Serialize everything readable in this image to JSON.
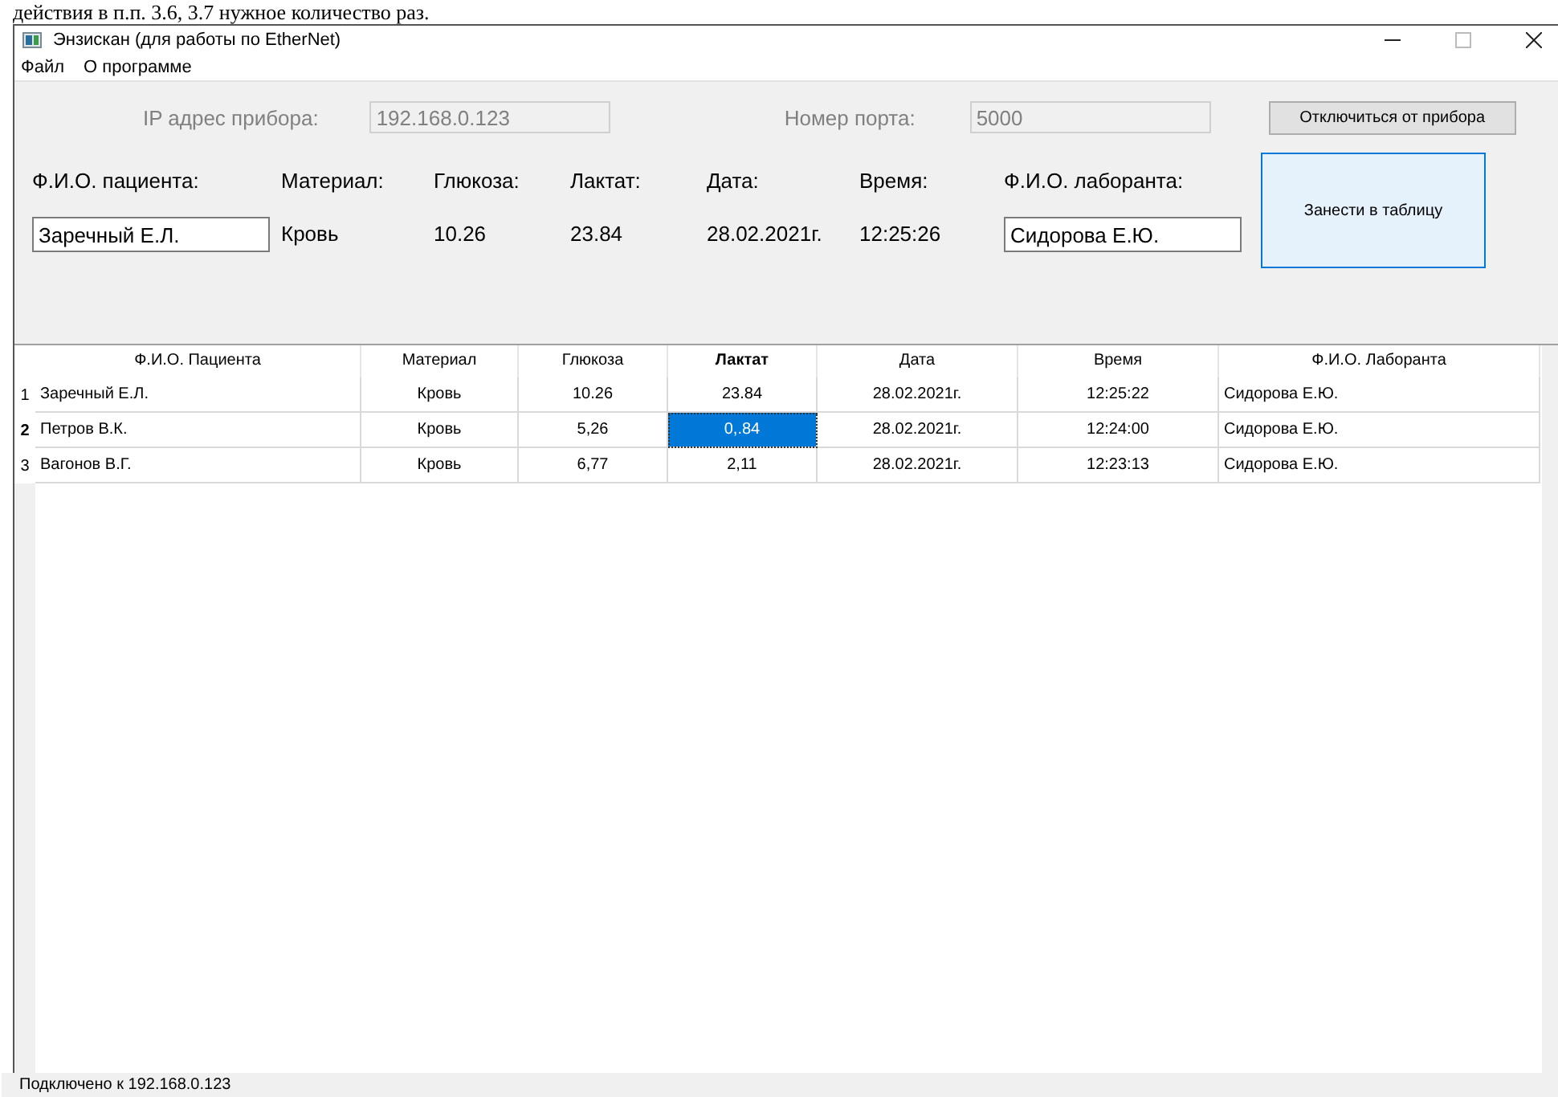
{
  "document_text": "действия в п.п. 3.6, 3.7 нужное количество раз.",
  "window": {
    "title": "Энзискан (для работы по EtherNet)"
  },
  "menu": [
    "Файл",
    "О программе"
  ],
  "connection": {
    "ip_label": "IP адрес прибора:",
    "ip_value": "192.168.0.123",
    "port_label": "Номер порта:",
    "port_value": "5000",
    "disconnect_button": "Отключиться от прибора"
  },
  "entry": {
    "fields": [
      {
        "kind": "input",
        "label": "Ф.И.О. пациента:",
        "value": "Заречный Е.Л."
      },
      {
        "kind": "text",
        "label": "Материал:",
        "value": "Кровь"
      },
      {
        "kind": "text",
        "label": "Глюкоза:",
        "value": "10.26"
      },
      {
        "kind": "text",
        "label": "Лактат:",
        "value": "23.84"
      },
      {
        "kind": "text",
        "label": "Дата:",
        "value": "28.02.2021г."
      },
      {
        "kind": "text",
        "label": "Время:",
        "value": "12:25:26"
      },
      {
        "kind": "input",
        "label": "Ф.И.О. лаборанта:",
        "value": "Сидорова Е.Ю."
      }
    ],
    "add_button": "Занести в таблицу"
  },
  "table": {
    "columns": [
      {
        "label": "Ф.И.О. Пациента",
        "kind": "name",
        "current": false
      },
      {
        "label": "Материал",
        "kind": "value",
        "current": false
      },
      {
        "label": "Глюкоза",
        "kind": "value",
        "current": false
      },
      {
        "label": "Лактат",
        "kind": "value",
        "current": true
      },
      {
        "label": "Дата",
        "kind": "value",
        "current": false
      },
      {
        "label": "Время",
        "kind": "value",
        "current": false
      },
      {
        "label": "Ф.И.О. Лаборанта",
        "kind": "name",
        "current": false
      }
    ],
    "rows": [
      {
        "number": "1",
        "current": false,
        "cells": [
          {
            "text": "Заречный Е.Л.",
            "selected": false
          },
          {
            "text": "Кровь",
            "selected": false
          },
          {
            "text": "10.26",
            "selected": false
          },
          {
            "text": "23.84",
            "selected": false
          },
          {
            "text": "28.02.2021г.",
            "selected": false
          },
          {
            "text": "12:25:22",
            "selected": false
          },
          {
            "text": "Сидорова Е.Ю.",
            "selected": false
          }
        ]
      },
      {
        "number": "2",
        "current": true,
        "cells": [
          {
            "text": "Петров В.К.",
            "selected": false
          },
          {
            "text": "Кровь",
            "selected": false
          },
          {
            "text": "5,26",
            "selected": false
          },
          {
            "text": "0,.84",
            "selected": true
          },
          {
            "text": "28.02.2021г.",
            "selected": false
          },
          {
            "text": "12:24:00",
            "selected": false
          },
          {
            "text": "Сидорова Е.Ю.",
            "selected": false
          }
        ]
      },
      {
        "number": "3",
        "current": false,
        "cells": [
          {
            "text": "Вагонов В.Г.",
            "selected": false
          },
          {
            "text": "Кровь",
            "selected": false
          },
          {
            "text": "6,77",
            "selected": false
          },
          {
            "text": "2,11",
            "selected": false
          },
          {
            "text": "28.02.2021г.",
            "selected": false
          },
          {
            "text": "12:23:13",
            "selected": false
          },
          {
            "text": "Сидорова Е.Ю.",
            "selected": false
          }
        ]
      }
    ]
  },
  "status_bar": "Подключено к 192.168.0.123"
}
